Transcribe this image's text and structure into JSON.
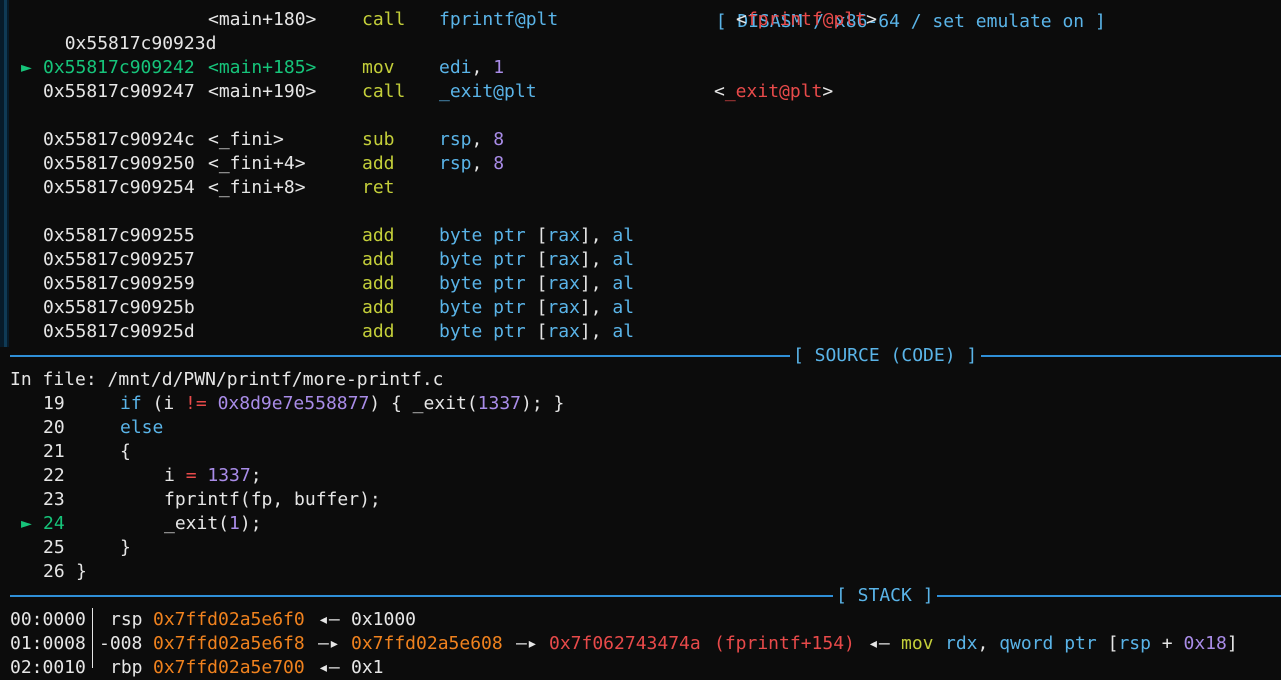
{
  "disasm": {
    "header": "[ DISASM / x86-64 / set emulate on ]",
    "lines": [
      {
        "arrow": "",
        "addr": "0x55817c90923d",
        "sym": "<main+180>",
        "mnem": "call",
        "ops": "fprintf@plt",
        "ann_open": "<",
        "ann_name": "fprintf@plt",
        "ann_close": ">"
      },
      {
        "arrow": "►",
        "addr": "0x55817c909242",
        "sym": "<main+185>",
        "mnem": "mov",
        "ops_reg": "edi",
        "ops_sep": ", ",
        "ops_num": "1"
      },
      {
        "arrow": "",
        "addr": "0x55817c909247",
        "sym": "<main+190>",
        "mnem": "call",
        "ops": "_exit@plt",
        "ann_open": "<",
        "ann_name": "_exit@plt",
        "ann_close": ">"
      },
      {
        "addr": "0x55817c90924c",
        "sym": "<_fini>",
        "mnem": "sub",
        "ops_reg": "rsp",
        "ops_sep": ", ",
        "ops_num": "8"
      },
      {
        "addr": "0x55817c909250",
        "sym": "<_fini+4>",
        "mnem": "add",
        "ops_reg": "rsp",
        "ops_sep": ", ",
        "ops_num": "8"
      },
      {
        "addr": "0x55817c909254",
        "sym": "<_fini+8>",
        "mnem": "ret"
      },
      {
        "addr": "0x55817c909255",
        "mnem": "add",
        "ptr_a": "byte ptr ",
        "ptr_b": "[",
        "ptr_reg": "rax",
        "ptr_c": "], ",
        "ptr_d": "al"
      },
      {
        "addr": "0x55817c909257",
        "mnem": "add",
        "ptr_a": "byte ptr ",
        "ptr_b": "[",
        "ptr_reg": "rax",
        "ptr_c": "], ",
        "ptr_d": "al"
      },
      {
        "addr": "0x55817c909259",
        "mnem": "add",
        "ptr_a": "byte ptr ",
        "ptr_b": "[",
        "ptr_reg": "rax",
        "ptr_c": "], ",
        "ptr_d": "al"
      },
      {
        "addr": "0x55817c90925b",
        "mnem": "add",
        "ptr_a": "byte ptr ",
        "ptr_b": "[",
        "ptr_reg": "rax",
        "ptr_c": "], ",
        "ptr_d": "al"
      },
      {
        "addr": "0x55817c90925d",
        "mnem": "add",
        "ptr_a": "byte ptr ",
        "ptr_b": "[",
        "ptr_reg": "rax",
        "ptr_c": "], ",
        "ptr_d": "al"
      }
    ]
  },
  "source": {
    "header": "[ SOURCE (CODE) ]",
    "file_label": "In file: ",
    "file_path": "/mnt/d/PWN/printf/more-printf.c",
    "current_arrow": "►",
    "lines": [
      {
        "num": "19",
        "t1": "if",
        "t2": " (i ",
        "t3": "!=",
        "t4": " ",
        "t5": "0x8d9e7e558877",
        "t6": ") { _exit(",
        "t7": "1337",
        "t8": "); }"
      },
      {
        "num": "20",
        "t1": "else"
      },
      {
        "num": "21",
        "t1": "{"
      },
      {
        "num": "22",
        "t1": "i ",
        "t2": "=",
        "t3": " ",
        "t4": "1337",
        "t5": ";"
      },
      {
        "num": "23",
        "t1": "fprintf(fp, buffer);"
      },
      {
        "num": "24",
        "t1": "_exit(",
        "t2": "1",
        "t3": ");"
      },
      {
        "num": "25",
        "t1": "}"
      },
      {
        "num": "26",
        "t1": "}"
      }
    ]
  },
  "stack": {
    "header": "[ STACK ]",
    "rows": [
      {
        "off": "00:0000",
        "reg": "rsp",
        "addr": "0x7ffd02a5e6f0",
        "arrow": "◂—",
        "val": "0x1000"
      },
      {
        "off": "01:0008",
        "reg": "-008",
        "addr": "0x7ffd02a5e6f8",
        "arrow1": "—▸",
        "addr2": "0x7ffd02a5e608",
        "arrow2": "—▸",
        "addr3": "0x7f062743474a",
        "sym": "(fprintf+154)",
        "arrow3": "◂—",
        "mnem": "mov",
        "ins_reg": "rdx",
        "ins_rest": "qword ptr",
        "ins_br_open": "[",
        "ins_reg2": "rsp",
        "ins_plus": "+",
        "ins_num": "0x18",
        "ins_br_close": "]"
      },
      {
        "off": "02:0010",
        "reg": "rbp",
        "addr": "0x7ffd02a5e700",
        "arrow": "◂—",
        "val": "0x1"
      }
    ]
  },
  "colors": {
    "background": "#0c0c0c",
    "text": "#e6e6e6",
    "current_line": "#16c47a",
    "mnemonic": "#c4cf3a",
    "register": "#5ab4e8",
    "number": "#a98ce8",
    "symbol_ref": "#e84a4a",
    "stack_addr": "#f0821e",
    "separator": "#2f8fd8"
  }
}
